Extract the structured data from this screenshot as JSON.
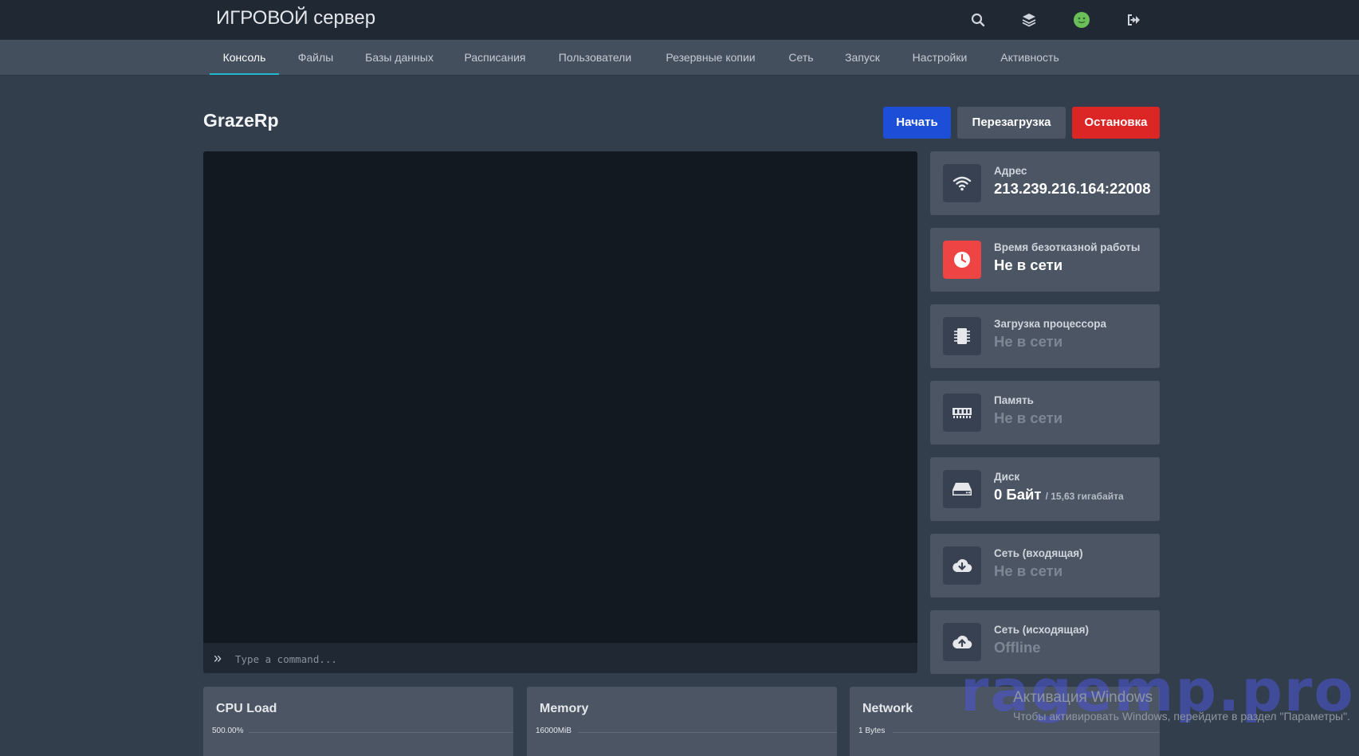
{
  "header": {
    "brand": "ИГРОВОЙ сервер",
    "icons": [
      "search-icon",
      "layers-icon",
      "avatar",
      "logout-icon"
    ]
  },
  "tabs": [
    {
      "label": "Консоль",
      "active": true
    },
    {
      "label": "Файлы"
    },
    {
      "label": "Базы данных"
    },
    {
      "label": "Расписания"
    },
    {
      "label": "Пользователи"
    },
    {
      "label": "Резервные копии"
    },
    {
      "label": "Сеть"
    },
    {
      "label": "Запуск"
    },
    {
      "label": "Настройки"
    },
    {
      "label": "Активность"
    }
  ],
  "server": {
    "name": "GrazeRp",
    "start_label": "Начать",
    "restart_label": "Перезагрузка",
    "stop_label": "Остановка"
  },
  "console": {
    "prompt": "»",
    "placeholder": "Type a command..."
  },
  "stats": [
    {
      "label": "Адрес",
      "value": "213.239.216.164:22008",
      "icon": "wifi-icon"
    },
    {
      "label": "Время безотказной работы",
      "value": "Не в сети",
      "icon": "clock-icon"
    },
    {
      "label": "Загрузка процессора",
      "value": "Не в сети",
      "icon": "cpu-icon"
    },
    {
      "label": "Память",
      "value": "Не в сети",
      "icon": "memory-icon"
    },
    {
      "label": "Диск",
      "value": "0 Байт",
      "sub": "/ 15,63 гигабайта",
      "icon": "hdd-icon"
    },
    {
      "label": "Сеть (входящая)",
      "value": "Не в сети",
      "icon": "cloud-download-icon"
    },
    {
      "label": "Сеть (исходящая)",
      "value": "Offline",
      "icon": "cloud-upload-icon"
    }
  ],
  "graphs": [
    {
      "title": "CPU Load",
      "ylabel": "500.00%"
    },
    {
      "title": "Memory",
      "ylabel": "16000MiB"
    },
    {
      "title": "Network",
      "ylabel": "1 Bytes"
    }
  ],
  "overlay": {
    "watermark": "ragemp.pro",
    "win_title": "Активация Windows",
    "win_sub": "Чтобы активировать Windows, перейдите в раздел \"Параметры\"."
  },
  "colors": {
    "accent_tab": "#22b8cf",
    "start": "#1d4ed8",
    "restart": "#4b5563",
    "stop": "#dc2626",
    "uptime_icon_bg": "#ef4444"
  }
}
